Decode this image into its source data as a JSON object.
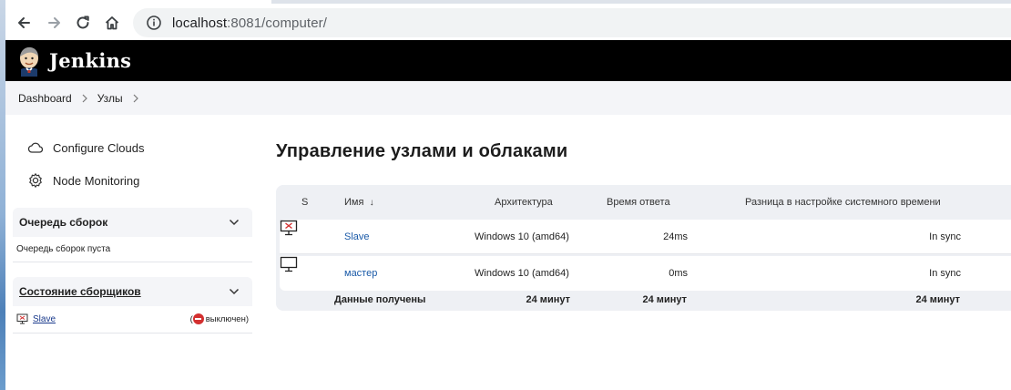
{
  "browser": {
    "url_host": "localhost",
    "url_rest": ":8081/computer/",
    "back_icon": "back-arrow-icon",
    "forward_icon": "forward-arrow-icon",
    "reload_icon": "reload-icon",
    "home_icon": "home-icon",
    "info_icon": "info-icon"
  },
  "header": {
    "title": "Jenkins",
    "logo_icon": "jenkins-butler-logo"
  },
  "breadcrumb": {
    "items": [
      "Dashboard",
      "Узлы"
    ]
  },
  "sidebar": {
    "tasks": [
      {
        "label": "Configure Clouds",
        "icon": "cloud-icon"
      },
      {
        "label": "Node Monitoring",
        "icon": "gear-icon"
      }
    ],
    "queue": {
      "title": "Очередь сборок",
      "empty_text": "Очередь сборок пуста"
    },
    "executors": {
      "title": "Состояние сборщиков",
      "node_name": "Slave",
      "node_status": "выключен"
    }
  },
  "main": {
    "title": "Управление узлами и облаками",
    "table": {
      "headers": {
        "status": "S",
        "name": "Имя",
        "sort_indicator": "↓",
        "arch": "Архитектура",
        "response": "Время ответа",
        "clock": "Разница в настройке системного времени"
      },
      "rows": [
        {
          "icon": "computer-offline-icon",
          "name": "Slave",
          "arch": "Windows 10 (amd64)",
          "response": "24ms",
          "clock": "In sync"
        },
        {
          "icon": "computer-icon",
          "name": "мастер",
          "arch": "Windows 10 (amd64)",
          "response": "0ms",
          "clock": "In sync"
        }
      ],
      "footer": {
        "label": "Данные получены",
        "arch_age": "24 минут",
        "response_age": "24 минут",
        "clock_age": "24 минут"
      }
    }
  },
  "colors": {
    "header_bg": "#000000",
    "link": "#1a5aa8",
    "offline_red": "#d32f2f",
    "breadcrumb_bg": "#f4f5f8"
  }
}
